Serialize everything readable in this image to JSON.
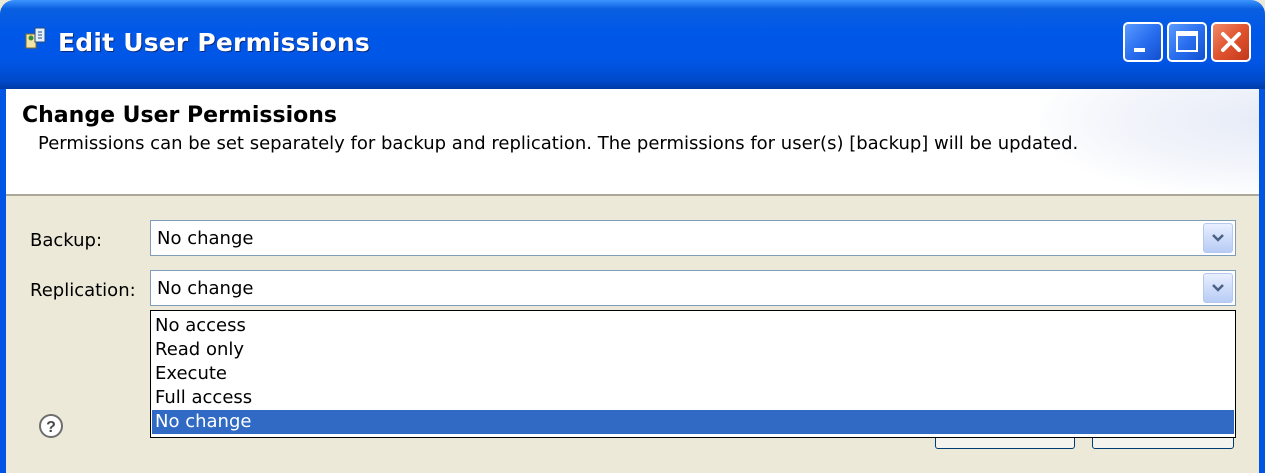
{
  "window": {
    "title": "Edit User Permissions",
    "accent": "#0055E5"
  },
  "header": {
    "title": "Change User Permissions",
    "description": "Permissions can be set separately for backup and replication. The permissions for user(s) [backup] will be updated."
  },
  "form": {
    "backup": {
      "label": "Backup:",
      "value": "No change"
    },
    "replication": {
      "label": "Replication:",
      "value": "No change"
    }
  },
  "dropdown": {
    "options": [
      "No access",
      "Read only",
      "Execute",
      "Full access",
      "No change"
    ],
    "selected": "No change",
    "selected_color": "#316AC5"
  },
  "icons": {
    "app": "app-icon",
    "minimize": "minimize-icon",
    "maximize": "maximize-icon",
    "close": "close-icon",
    "help": "help-icon",
    "dropdown": "chevron-down-icon"
  }
}
